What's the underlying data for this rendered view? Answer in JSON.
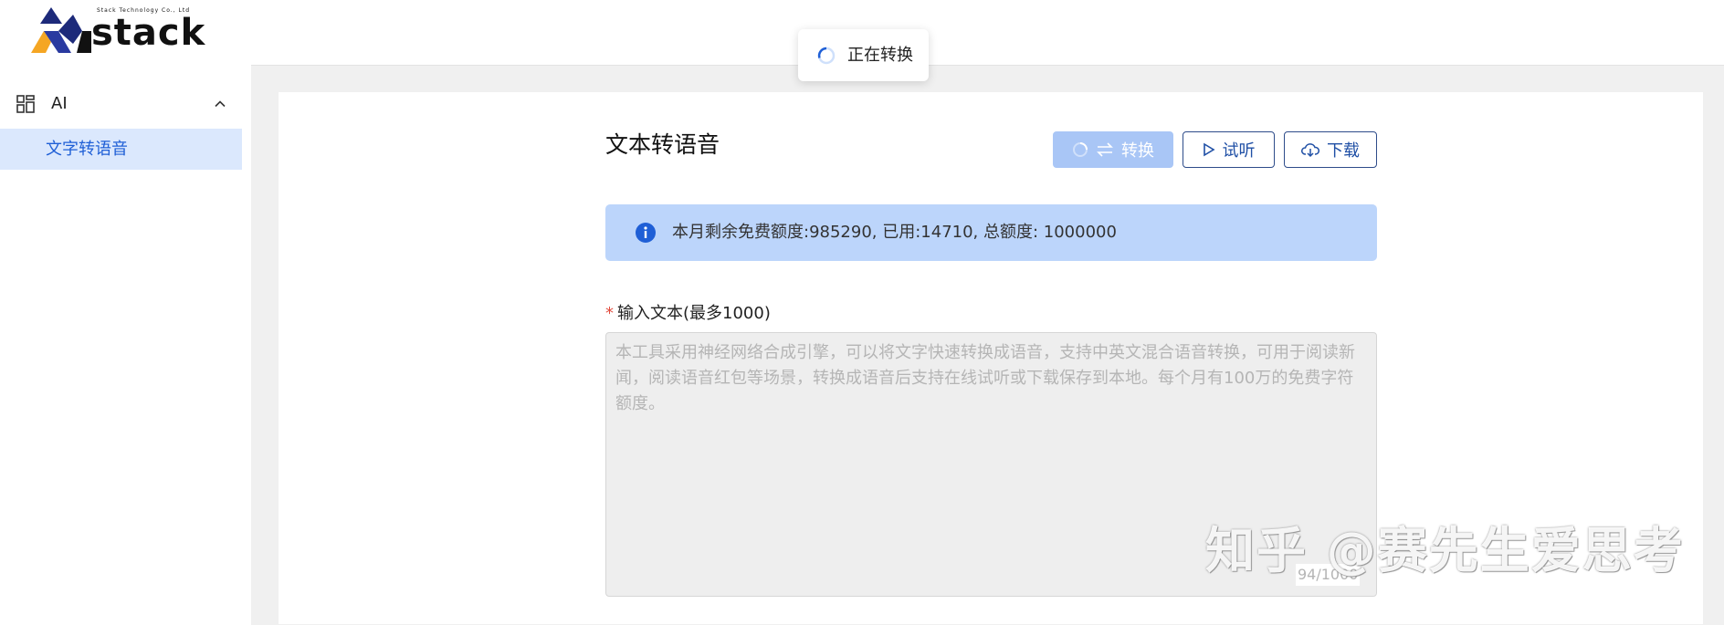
{
  "brand": {
    "tagline": "Stack Technology Co., Ltd",
    "wordmark": "stack",
    "colors": {
      "navy": "#1d2a7a",
      "orange": "#f5a623"
    }
  },
  "sidebar": {
    "group": {
      "label": "AI",
      "icon": "grid-icon",
      "expanded": true
    },
    "items": [
      {
        "label": "文字转语音",
        "active": true
      }
    ]
  },
  "toast": {
    "text": "正在转换",
    "icon": "spinner-icon"
  },
  "page": {
    "title": "文本转语音"
  },
  "toolbar": {
    "convert_label": "转换",
    "listen_label": "试听",
    "download_label": "下载"
  },
  "quota": {
    "text": "本月剩余免费额度:985290, 已用:14710, 总额度: 1000000"
  },
  "form": {
    "label": "输入文本(最多1000)",
    "required_mark": "*",
    "placeholder": "本工具采用神经网络合成引擎，可以将文字快速转换成语音，支持中英文混合语音转换，可用于阅读新闻，阅读语音红包等场景，转换成语音后支持在线试听或下载保存到本地。每个月有100万的免费字符额度。",
    "value": "",
    "counter": "94/1000"
  },
  "watermark": {
    "text": "知乎 @赛先生爱思考"
  },
  "colors": {
    "primary": "#1f5fd6",
    "primary_light": "#a9c6f6",
    "info_bg": "#bcd5fb",
    "active_bg": "#dbe8fd",
    "required": "#e14a3c"
  }
}
